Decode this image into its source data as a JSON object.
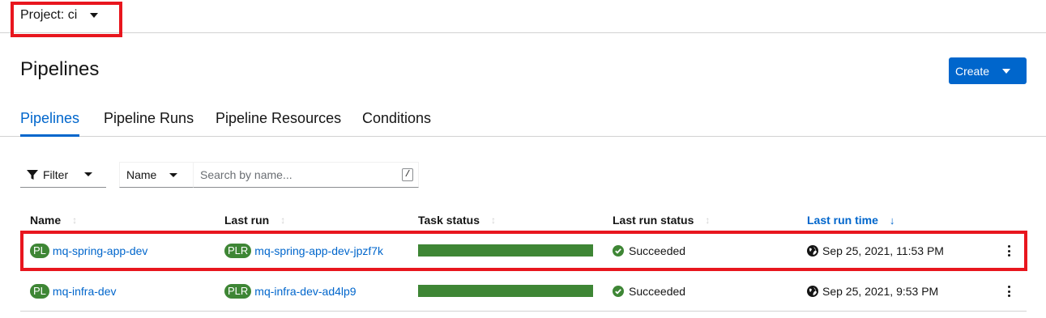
{
  "project": {
    "label": "Project: ci"
  },
  "page": {
    "title": "Pipelines"
  },
  "create_button": {
    "label": "Create"
  },
  "tabs": [
    {
      "label": "Pipelines",
      "active": true
    },
    {
      "label": "Pipeline Runs",
      "active": false
    },
    {
      "label": "Pipeline Resources",
      "active": false
    },
    {
      "label": "Conditions",
      "active": false
    }
  ],
  "toolbar": {
    "filter_label": "Filter",
    "name_select": "Name",
    "search_placeholder": "Search by name...",
    "search_shortcut": "/"
  },
  "table": {
    "columns": [
      "Name",
      "Last run",
      "Task status",
      "Last run status",
      "Last run time"
    ],
    "sorted_column": "Last run time",
    "rows": [
      {
        "name_badge": "PL",
        "name": "mq-spring-app-dev",
        "last_run_badge": "PLR",
        "last_run": "mq-spring-app-dev-jpzf7k",
        "task_status_complete": 1.0,
        "status": "Succeeded",
        "last_run_time": "Sep 25, 2021, 11:53 PM"
      },
      {
        "name_badge": "PL",
        "name": "mq-infra-dev",
        "last_run_badge": "PLR",
        "last_run": "mq-infra-dev-ad4lp9",
        "task_status_complete": 1.0,
        "status": "Succeeded",
        "last_run_time": "Sep 25, 2021, 9:53 PM"
      }
    ]
  },
  "colors": {
    "accent": "#0066cc",
    "success": "#3e8635",
    "highlight": "#e8161e"
  },
  "icons": [
    "caret-down-icon",
    "filter-icon",
    "sort-icon",
    "sort-down-icon",
    "check-circle-icon",
    "globe-icon",
    "kebab-icon"
  ]
}
